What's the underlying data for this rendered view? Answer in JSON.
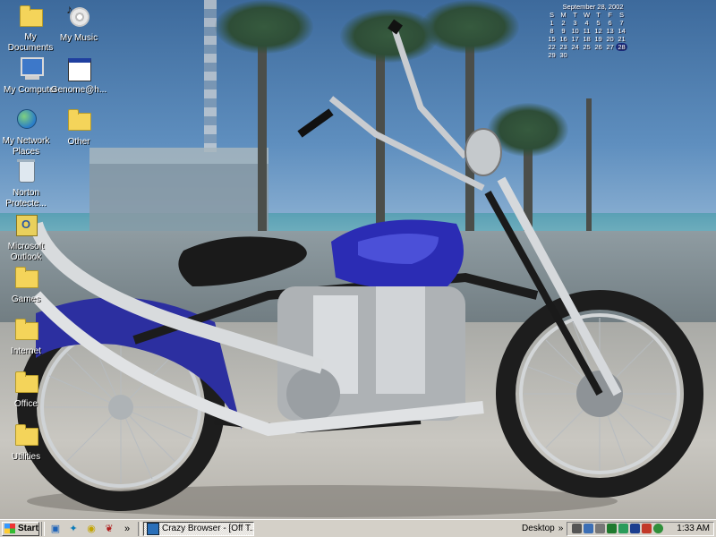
{
  "desktop": {
    "icons": [
      {
        "label": "My Documents",
        "icon": "folder-documents-icon"
      },
      {
        "label": "My Music",
        "icon": "music-cd-icon"
      },
      {
        "label": "My Computer",
        "icon": "computer-icon"
      },
      {
        "label": "Genome@h...",
        "icon": "application-window-icon"
      },
      {
        "label": "My Network Places",
        "icon": "network-places-icon"
      },
      {
        "label": "Other",
        "icon": "folder-icon"
      },
      {
        "label": "Norton Protecte...",
        "icon": "recycle-bin-icon"
      },
      {
        "label": "Microsoft Outlook",
        "icon": "outlook-icon"
      },
      {
        "label": "Games",
        "icon": "folder-icon"
      },
      {
        "label": "Internet",
        "icon": "folder-icon"
      },
      {
        "label": "Office",
        "icon": "folder-icon"
      },
      {
        "label": "Utilities",
        "icon": "folder-icon"
      }
    ],
    "calendar": {
      "title": "September 28, 2002",
      "weekdays": [
        "S",
        "M",
        "T",
        "W",
        "T",
        "F",
        "S"
      ],
      "weeks": [
        [
          "1",
          "2",
          "3",
          "4",
          "5",
          "6",
          "7"
        ],
        [
          "8",
          "9",
          "10",
          "11",
          "12",
          "13",
          "14"
        ],
        [
          "15",
          "16",
          "17",
          "18",
          "19",
          "20",
          "21"
        ],
        [
          "22",
          "23",
          "24",
          "25",
          "26",
          "27",
          "28"
        ],
        [
          "29",
          "30",
          "",
          "",
          "",
          "",
          ""
        ]
      ],
      "today": "28"
    }
  },
  "taskbar": {
    "start_label": "Start",
    "quicklaunch_more": "»",
    "tasks": [
      {
        "label": "Crazy Browser - [Off T...",
        "icon": "browser-icon"
      }
    ],
    "desktop_toolbar_label": "Desktop",
    "desktop_toolbar_more": "»",
    "clock": "1:33 AM"
  },
  "colors": {
    "taskbar_face": "#d4d0c8",
    "calendar_today": "#1a2a7a",
    "folder": "#f4d45a"
  }
}
